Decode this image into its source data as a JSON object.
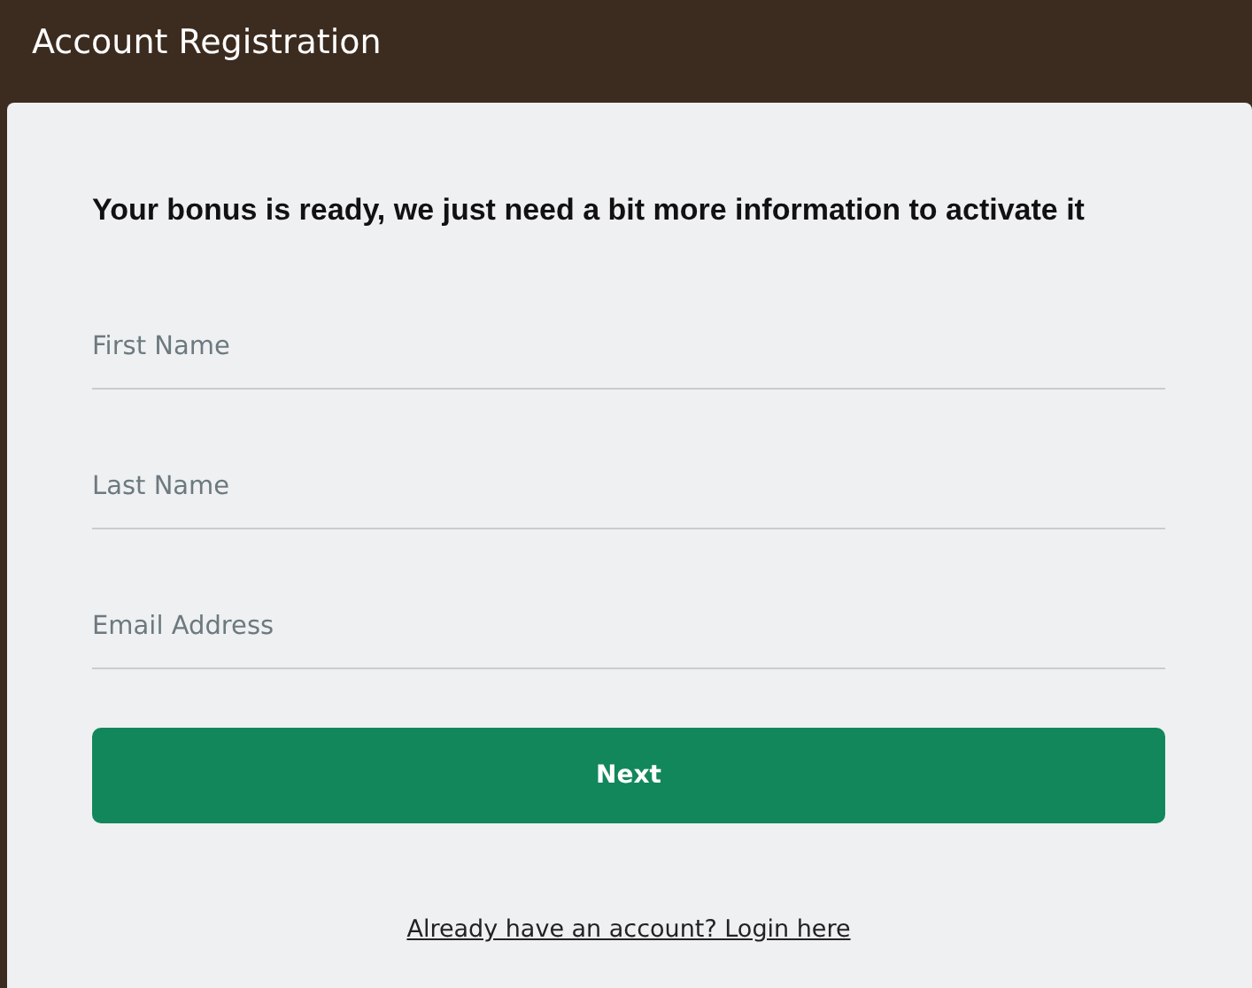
{
  "header": {
    "title": "Account Registration"
  },
  "form": {
    "heading": "Your bonus is ready, we just need a bit more information to activate it",
    "fields": [
      {
        "placeholder": "First Name"
      },
      {
        "placeholder": "Last Name"
      },
      {
        "placeholder": "Email Address"
      }
    ],
    "button": "Next",
    "login_link": "Already have an account? Login here"
  }
}
